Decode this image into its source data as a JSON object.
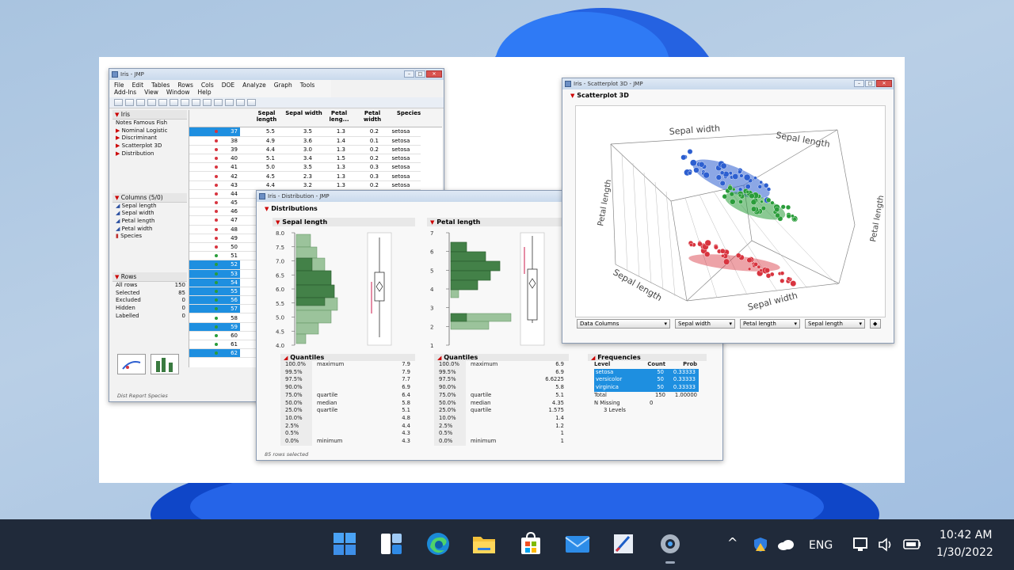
{
  "colors": {
    "selection": "#1e8fe0",
    "setosa": "#d8343f",
    "versicolor": "#2a9d3a",
    "virginica": "#2d5fd0",
    "histogram": "#3a7a40"
  },
  "jmp_main": {
    "title": "Iris - JMP",
    "menu": [
      "File",
      "Edit",
      "Tables",
      "Rows",
      "Cols",
      "DOE",
      "Analyze",
      "Graph",
      "Tools",
      "Add-Ins",
      "View",
      "Window",
      "Help"
    ],
    "table_panel": {
      "name": "Iris",
      "items": [
        "Notes  Famous Fish",
        "Nominal Logistic",
        "Discriminant",
        "Scatterplot 3D",
        "Distribution"
      ]
    },
    "columns_panel": {
      "header": "Columns (5/0)",
      "items": [
        "Sepal length",
        "Sepal width",
        "Petal length",
        "Petal width",
        "Species"
      ]
    },
    "rows_panel": {
      "header": "Rows",
      "items": [
        {
          "label": "All rows",
          "value": "150"
        },
        {
          "label": "Selected",
          "value": "85"
        },
        {
          "label": "Excluded",
          "value": "0"
        },
        {
          "label": "Hidden",
          "value": "0"
        },
        {
          "label": "Labelled",
          "value": "0"
        }
      ]
    },
    "status": "Dist Report Species",
    "grid_headers": [
      "Sepal length",
      "Sepal width",
      "Petal leng...",
      "Petal width",
      "Species"
    ],
    "rows": [
      {
        "n": "37",
        "sl": "5.5",
        "sw": "3.5",
        "pl": "1.3",
        "pw": "0.2",
        "sp": "setosa",
        "sel": true
      },
      {
        "n": "38",
        "sl": "4.9",
        "sw": "3.6",
        "pl": "1.4",
        "pw": "0.1",
        "sp": "setosa",
        "sel": false
      },
      {
        "n": "39",
        "sl": "4.4",
        "sw": "3.0",
        "pl": "1.3",
        "pw": "0.2",
        "sp": "setosa",
        "sel": false
      },
      {
        "n": "40",
        "sl": "5.1",
        "sw": "3.4",
        "pl": "1.5",
        "pw": "0.2",
        "sp": "setosa",
        "sel": false
      },
      {
        "n": "41",
        "sl": "5.0",
        "sw": "3.5",
        "pl": "1.3",
        "pw": "0.3",
        "sp": "setosa",
        "sel": false
      },
      {
        "n": "42",
        "sl": "4.5",
        "sw": "2.3",
        "pl": "1.3",
        "pw": "0.3",
        "sp": "setosa",
        "sel": false
      },
      {
        "n": "43",
        "sl": "4.4",
        "sw": "3.2",
        "pl": "1.3",
        "pw": "0.2",
        "sp": "setosa",
        "sel": false
      },
      {
        "n": "44",
        "sel": false
      },
      {
        "n": "45",
        "sel": false
      },
      {
        "n": "46",
        "sel": false
      },
      {
        "n": "47",
        "sel": false
      },
      {
        "n": "48",
        "sel": false
      },
      {
        "n": "49",
        "sel": false
      },
      {
        "n": "50",
        "sel": false
      },
      {
        "n": "51",
        "sel": false
      },
      {
        "n": "52",
        "sel": true
      },
      {
        "n": "53",
        "sel": true
      },
      {
        "n": "54",
        "sel": true
      },
      {
        "n": "55",
        "sel": true
      },
      {
        "n": "56",
        "sel": true
      },
      {
        "n": "57",
        "sel": true
      },
      {
        "n": "58",
        "sel": false
      },
      {
        "n": "59",
        "sel": true
      },
      {
        "n": "60",
        "sel": false
      },
      {
        "n": "61",
        "sel": false
      },
      {
        "n": "62",
        "sel": true
      }
    ]
  },
  "distribution_win": {
    "title": "Iris - Distribution - JMP",
    "section": "Distributions",
    "sepal": {
      "title": "Sepal length",
      "ticks": [
        "8.0",
        "7.5",
        "7.0",
        "6.5",
        "6.0",
        "5.5",
        "5.0",
        "4.5",
        "4.0"
      ],
      "quantiles_title": "Quantiles",
      "quantiles": [
        [
          "100.0%",
          "maximum",
          "7.9"
        ],
        [
          "99.5%",
          "",
          "7.9"
        ],
        [
          "97.5%",
          "",
          "7.7"
        ],
        [
          "90.0%",
          "",
          "6.9"
        ],
        [
          "75.0%",
          "quartile",
          "6.4"
        ],
        [
          "50.0%",
          "median",
          "5.8"
        ],
        [
          "25.0%",
          "quartile",
          "5.1"
        ],
        [
          "10.0%",
          "",
          "4.8"
        ],
        [
          "2.5%",
          "",
          "4.4"
        ],
        [
          "0.5%",
          "",
          "4.3"
        ],
        [
          "0.0%",
          "minimum",
          "4.3"
        ]
      ]
    },
    "petal": {
      "title": "Petal length",
      "ticks": [
        "7",
        "6",
        "5",
        "4",
        "3",
        "2",
        "1"
      ],
      "quantiles_title": "Quantiles",
      "quantiles": [
        [
          "100.0%",
          "maximum",
          "6.9"
        ],
        [
          "99.5%",
          "",
          "6.9"
        ],
        [
          "97.5%",
          "",
          "6.6225"
        ],
        [
          "90.0%",
          "",
          "5.8"
        ],
        [
          "75.0%",
          "quartile",
          "5.1"
        ],
        [
          "50.0%",
          "median",
          "4.35"
        ],
        [
          "25.0%",
          "quartile",
          "1.575"
        ],
        [
          "10.0%",
          "",
          "1.4"
        ],
        [
          "2.5%",
          "",
          "1.2"
        ],
        [
          "0.5%",
          "",
          "1"
        ],
        [
          "0.0%",
          "minimum",
          "1"
        ]
      ]
    },
    "frequencies": {
      "title": "Frequencies",
      "headers": [
        "Level",
        "Count",
        "Prob"
      ],
      "rows": [
        [
          "setosa",
          "50",
          "0.33333"
        ],
        [
          "versicolor",
          "50",
          "0.33333"
        ],
        [
          "virginica",
          "50",
          "0.33333"
        ]
      ],
      "total": [
        "Total",
        "150",
        "1.00000"
      ],
      "missing": "N Missing",
      "missing_value": "0",
      "levels": "3  Levels"
    },
    "status": "85 rows selected"
  },
  "scatter_win": {
    "title": "Iris - Scatterplot 3D - JMP",
    "section": "Scatterplot 3D",
    "axis_labels": [
      "Sepal width",
      "Sepal length",
      "Petal length",
      "Petal length",
      "Sepal length",
      "Sepal width"
    ],
    "controls": [
      "Data Columns",
      "Sepal width",
      "Petal length",
      "Sepal length"
    ]
  },
  "taskbar": {
    "apps": [
      "start-icon",
      "widgets-icon",
      "edge-icon",
      "file-explorer-icon",
      "store-icon",
      "mail-icon",
      "paint-icon",
      "settings-icon"
    ],
    "language": "ENG",
    "time": "10:42 AM",
    "date": "1/30/2022"
  }
}
